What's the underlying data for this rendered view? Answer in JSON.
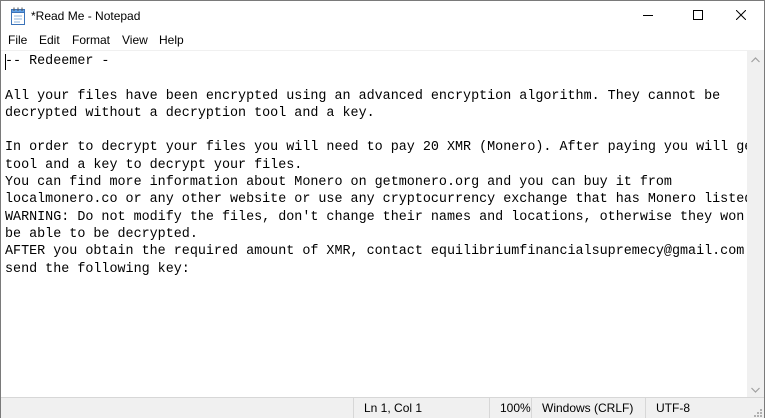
{
  "window": {
    "title": "*Read Me - Notepad",
    "icons": {
      "app": "notepad-icon",
      "minimize": "minimize-icon",
      "maximize": "maximize-icon",
      "close": "close-icon"
    }
  },
  "menu": {
    "items": [
      "File",
      "Edit",
      "Format",
      "View",
      "Help"
    ]
  },
  "editor": {
    "content": "-- Redeemer -\n\nAll your files have been encrypted using an advanced encryption algorithm. They cannot be\ndecrypted without a decryption tool and a key.\n\nIn order to decrypt your files you will need to pay 20 XMR (Monero). After paying you will get a\ntool and a key to decrypt your files.\nYou can find more information about Monero on getmonero.org and you can buy it from\nlocalmonero.co or any other website or use any cryptocurrency exchange that has Monero listed.\nWARNING: Do not modify the files, don't change their names and locations, otherwise they won't\nbe able to be decrypted.\nAFTER you obtain the required amount of XMR, contact equilibriumfinancialsupremecy@gmail.com and\nsend the following key:"
  },
  "statusbar": {
    "position": "Ln 1, Col 1",
    "zoom": "100%",
    "line_ending": "Windows (CRLF)",
    "encoding": "UTF-8"
  },
  "colors": {
    "chrome_background": "#f0f0f0",
    "editor_background": "#ffffff",
    "icon_blue": "#1e88e5"
  }
}
